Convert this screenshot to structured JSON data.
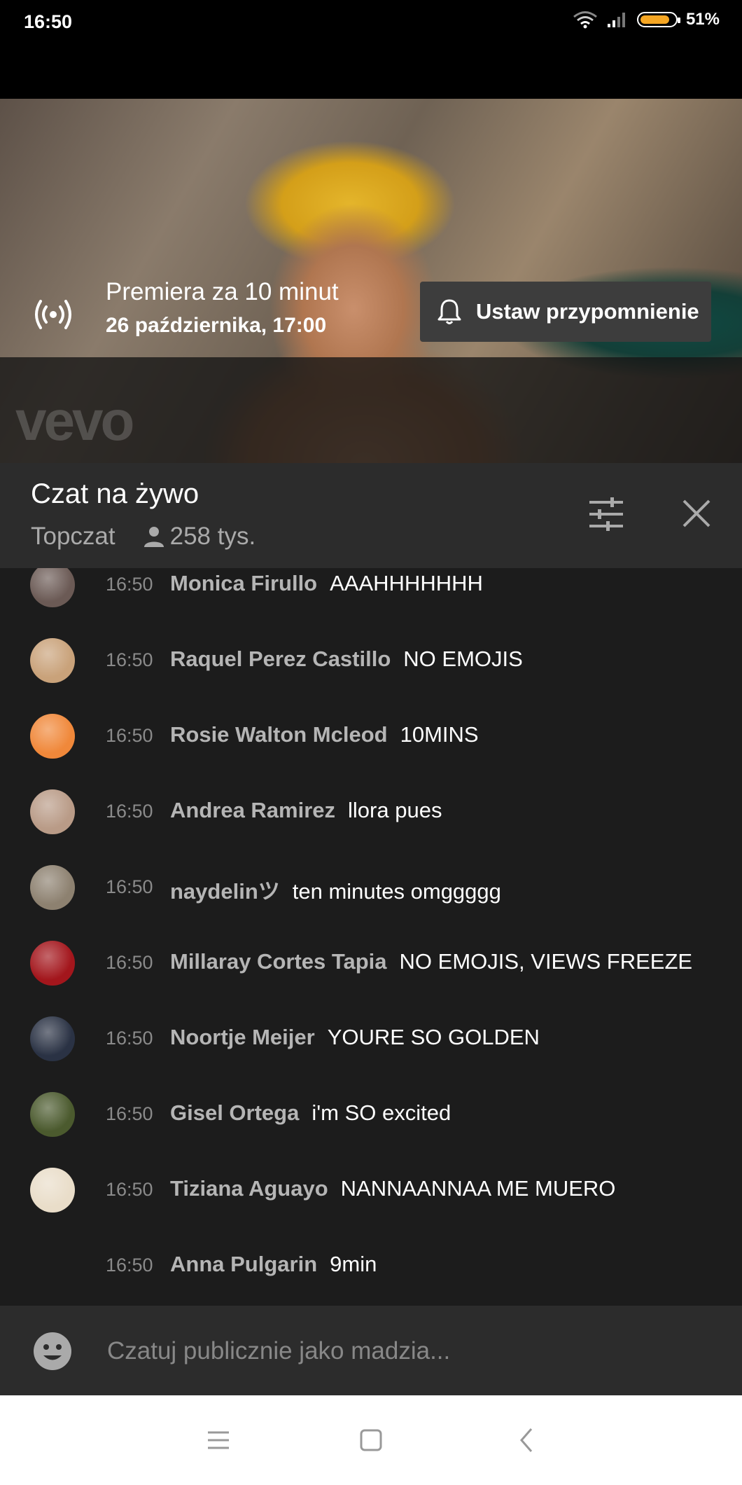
{
  "status_bar": {
    "time": "16:50",
    "battery": "51%"
  },
  "video": {
    "watermark": "vevo",
    "premiere_title": "Premiera za 10 minut",
    "premiere_date": "26 października, 17:00",
    "reminder_button": "Ustaw przypomnienie"
  },
  "chat": {
    "title": "Czat na żywo",
    "mode": "Topczat",
    "viewers": "258 tys.",
    "messages": [
      {
        "time": "16:50",
        "author": "Monica Firullo",
        "text": "AAAHHHHHHH",
        "avatar_color": "#6b5a55"
      },
      {
        "time": "16:50",
        "author": "Raquel Perez Castillo",
        "text": "NO EMOJIS",
        "avatar_color": "#c9a27a"
      },
      {
        "time": "16:50",
        "author": "Rosie Walton Mcleod",
        "text": "10MINS",
        "avatar_color": "#f0883a"
      },
      {
        "time": "16:50",
        "author": "Andrea Ramirez",
        "text": "llora pues",
        "avatar_color": "#b99b87"
      },
      {
        "time": "16:50",
        "author": "naydelinツ",
        "text": "ten minutes omggggg",
        "avatar_color": "#8d8170"
      },
      {
        "time": "16:50",
        "author": "Millaray Cortes Tapia",
        "text": "NO EMOJIS, VIEWS FREEZE",
        "avatar_color": "#a3161c"
      },
      {
        "time": "16:50",
        "author": "Noortje Meijer",
        "text": "YOURE SO GOLDEN",
        "avatar_color": "#2a3244"
      },
      {
        "time": "16:50",
        "author": "Gisel Ortega",
        "text": "i'm SO excited",
        "avatar_color": "#4b5a2e"
      },
      {
        "time": "16:50",
        "author": "Tiziana Aguayo",
        "text": "NANNAANNAA ME MUERO",
        "avatar_color": "#e9ddc9"
      },
      {
        "time": "16:50",
        "author": "Anna Pulgarin",
        "text": "9min",
        "avatar_color": ""
      }
    ]
  },
  "input": {
    "placeholder": "Czatuj publicznie jako madzia..."
  },
  "icons": {
    "live": "broadcast-icon",
    "bell": "bell-icon",
    "filter": "tune-sliders-icon",
    "close": "close-icon",
    "person": "person-icon",
    "emoji": "emoji-icon",
    "nav_menu": "menu-icon",
    "nav_home": "home-square-icon",
    "nav_back": "back-chevron-icon"
  }
}
